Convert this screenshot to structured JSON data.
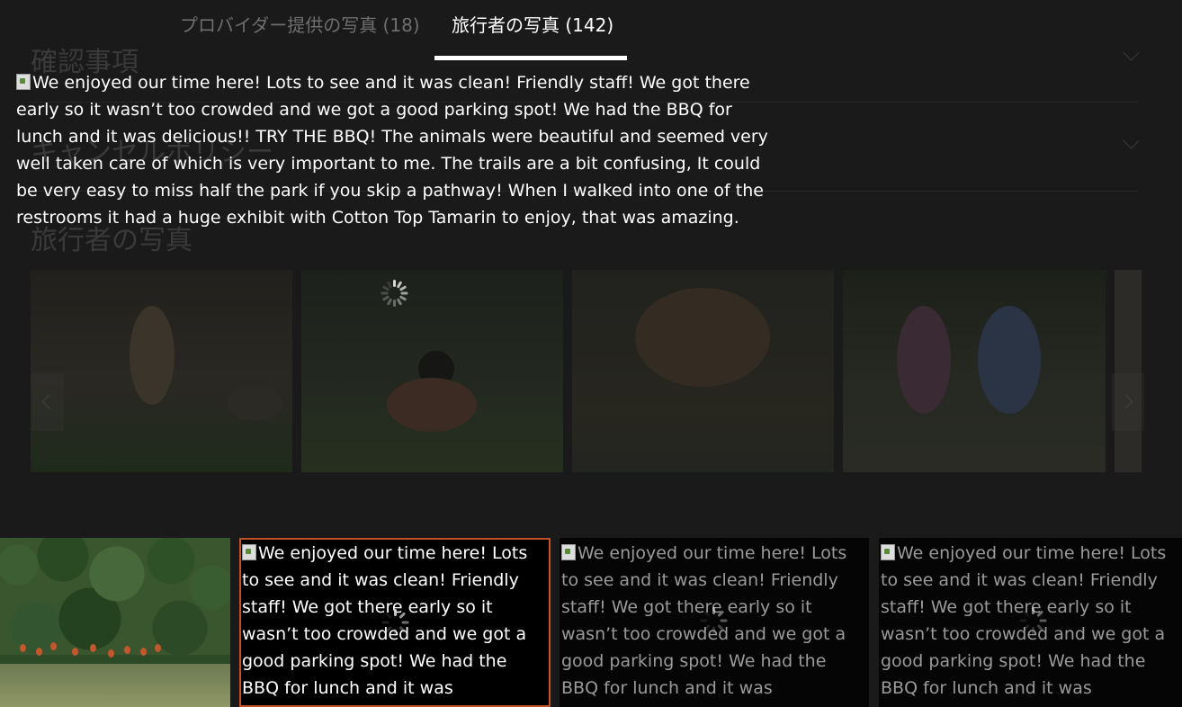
{
  "background_page": {
    "section_titles": [
      "確認事項",
      "キャンセルポリシー",
      "旅行者の写真"
    ]
  },
  "tabs": [
    {
      "label": "プロバイダー提供の写真 (18)",
      "selected": false
    },
    {
      "label": "旅行者の写真 (142)",
      "selected": true
    }
  ],
  "main_image": {
    "alt_text": "We enjoyed our time here! Lots to see and it was clean! Friendly staff! We got there early so it wasn’t too crowded and we got a good parking spot! We had the BBQ for lunch and it was delicious!! TRY THE BBQ! The animals were beautiful and seemed very well taken care of which is very important to me. The trails are a bit confusing, It could be very easy to miss half the park if you skip a pathway! When I walked into one of the restrooms it had a huge exhibit with Cotton Top Tamarin to enjoy, that was amazing."
  },
  "thumbnails": [
    {
      "alt_text": ""
    },
    {
      "alt_text": "We enjoyed our time here! Lots to see and it was clean! Friendly staff! We got there early so it wasn’t too crowded and we got a good parking spot! We had the BBQ for lunch and it was",
      "selected": true
    },
    {
      "alt_text": "We enjoyed our time here! Lots to see and it was clean! Friendly staff! We got there early so it wasn’t too crowded and we got a good parking spot! We had the BBQ for lunch and it was"
    },
    {
      "alt_text": "We enjoyed our time here! Lots to see and it was clean! Friendly staff! We got there early so it wasn’t too crowded and we got a good parking spot! We had the BBQ for lunch and it was"
    }
  ],
  "colors": {
    "selected_thumbnail_border": "#c0522a",
    "tab_underline": "#ffffff",
    "inactive_tab_text": "#6e6e6e"
  }
}
